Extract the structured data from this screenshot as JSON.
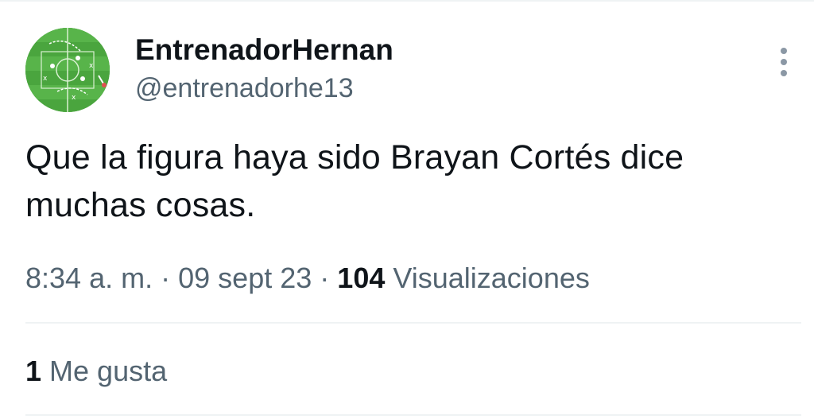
{
  "tweet": {
    "author": {
      "display_name": "EntrenadorHernan",
      "handle": "@entrenadorhe13",
      "avatar_icon": "tactics-board-avatar"
    },
    "more_icon": "more-vertical-icon",
    "text": "Que la figura haya sido Brayan Cortés dice muchas cosas.",
    "time": "8:34 a. m.",
    "separator": "·",
    "date": "09 sept 23",
    "views_count": "104",
    "views_label": "Visualizaciones",
    "likes_count": "1",
    "likes_label": "Me gusta"
  },
  "colors": {
    "text_primary": "#0f1419",
    "text_secondary": "#536471",
    "divider": "#eff3f4",
    "avatar_green": "#4aa53e"
  }
}
